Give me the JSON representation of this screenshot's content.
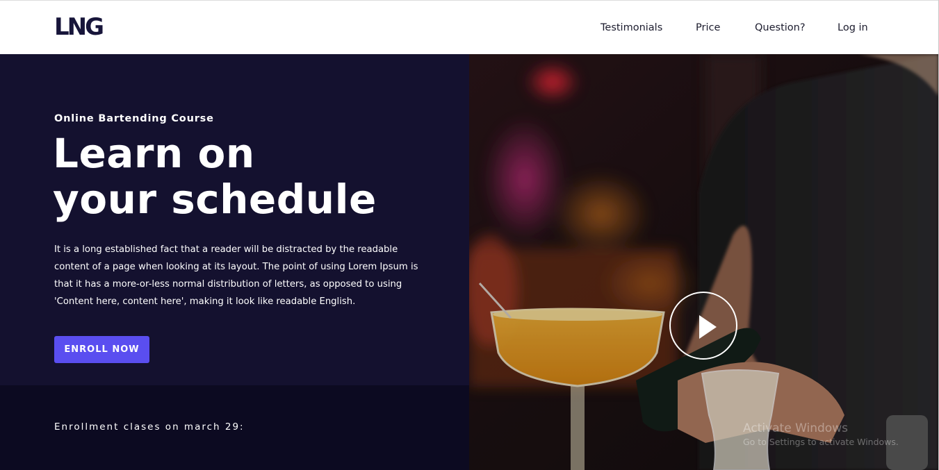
{
  "header": {
    "logo": "LNG",
    "nav": [
      "Testimonials",
      "Price",
      "Question?",
      "Log in"
    ]
  },
  "hero": {
    "eyebrow": "Online Bartending Course",
    "headline": [
      "Learn on",
      "your schedule"
    ],
    "body_lines": [
      "It is a long established fact that a reader will be distracted by the readable",
      "content of a page when looking at its layout. The point of using Lorem Ipsum is",
      "that it has a more-or-less normal distribution of letters, as opposed to using",
      "'Content here, content here', making it look like readable English."
    ],
    "cta": "ENROLL NOW",
    "enrollment_note": "Enrollment clases on march 29:"
  },
  "media": {
    "play_icon": "play-icon",
    "watermark_title": "Activate Windows",
    "watermark_sub": "Go to Settings to activate Windows."
  },
  "colors": {
    "hero_bg": "#14112f",
    "band_bg": "#0c0a21",
    "accent": "#5a4ef0",
    "logo": "#17153a"
  }
}
